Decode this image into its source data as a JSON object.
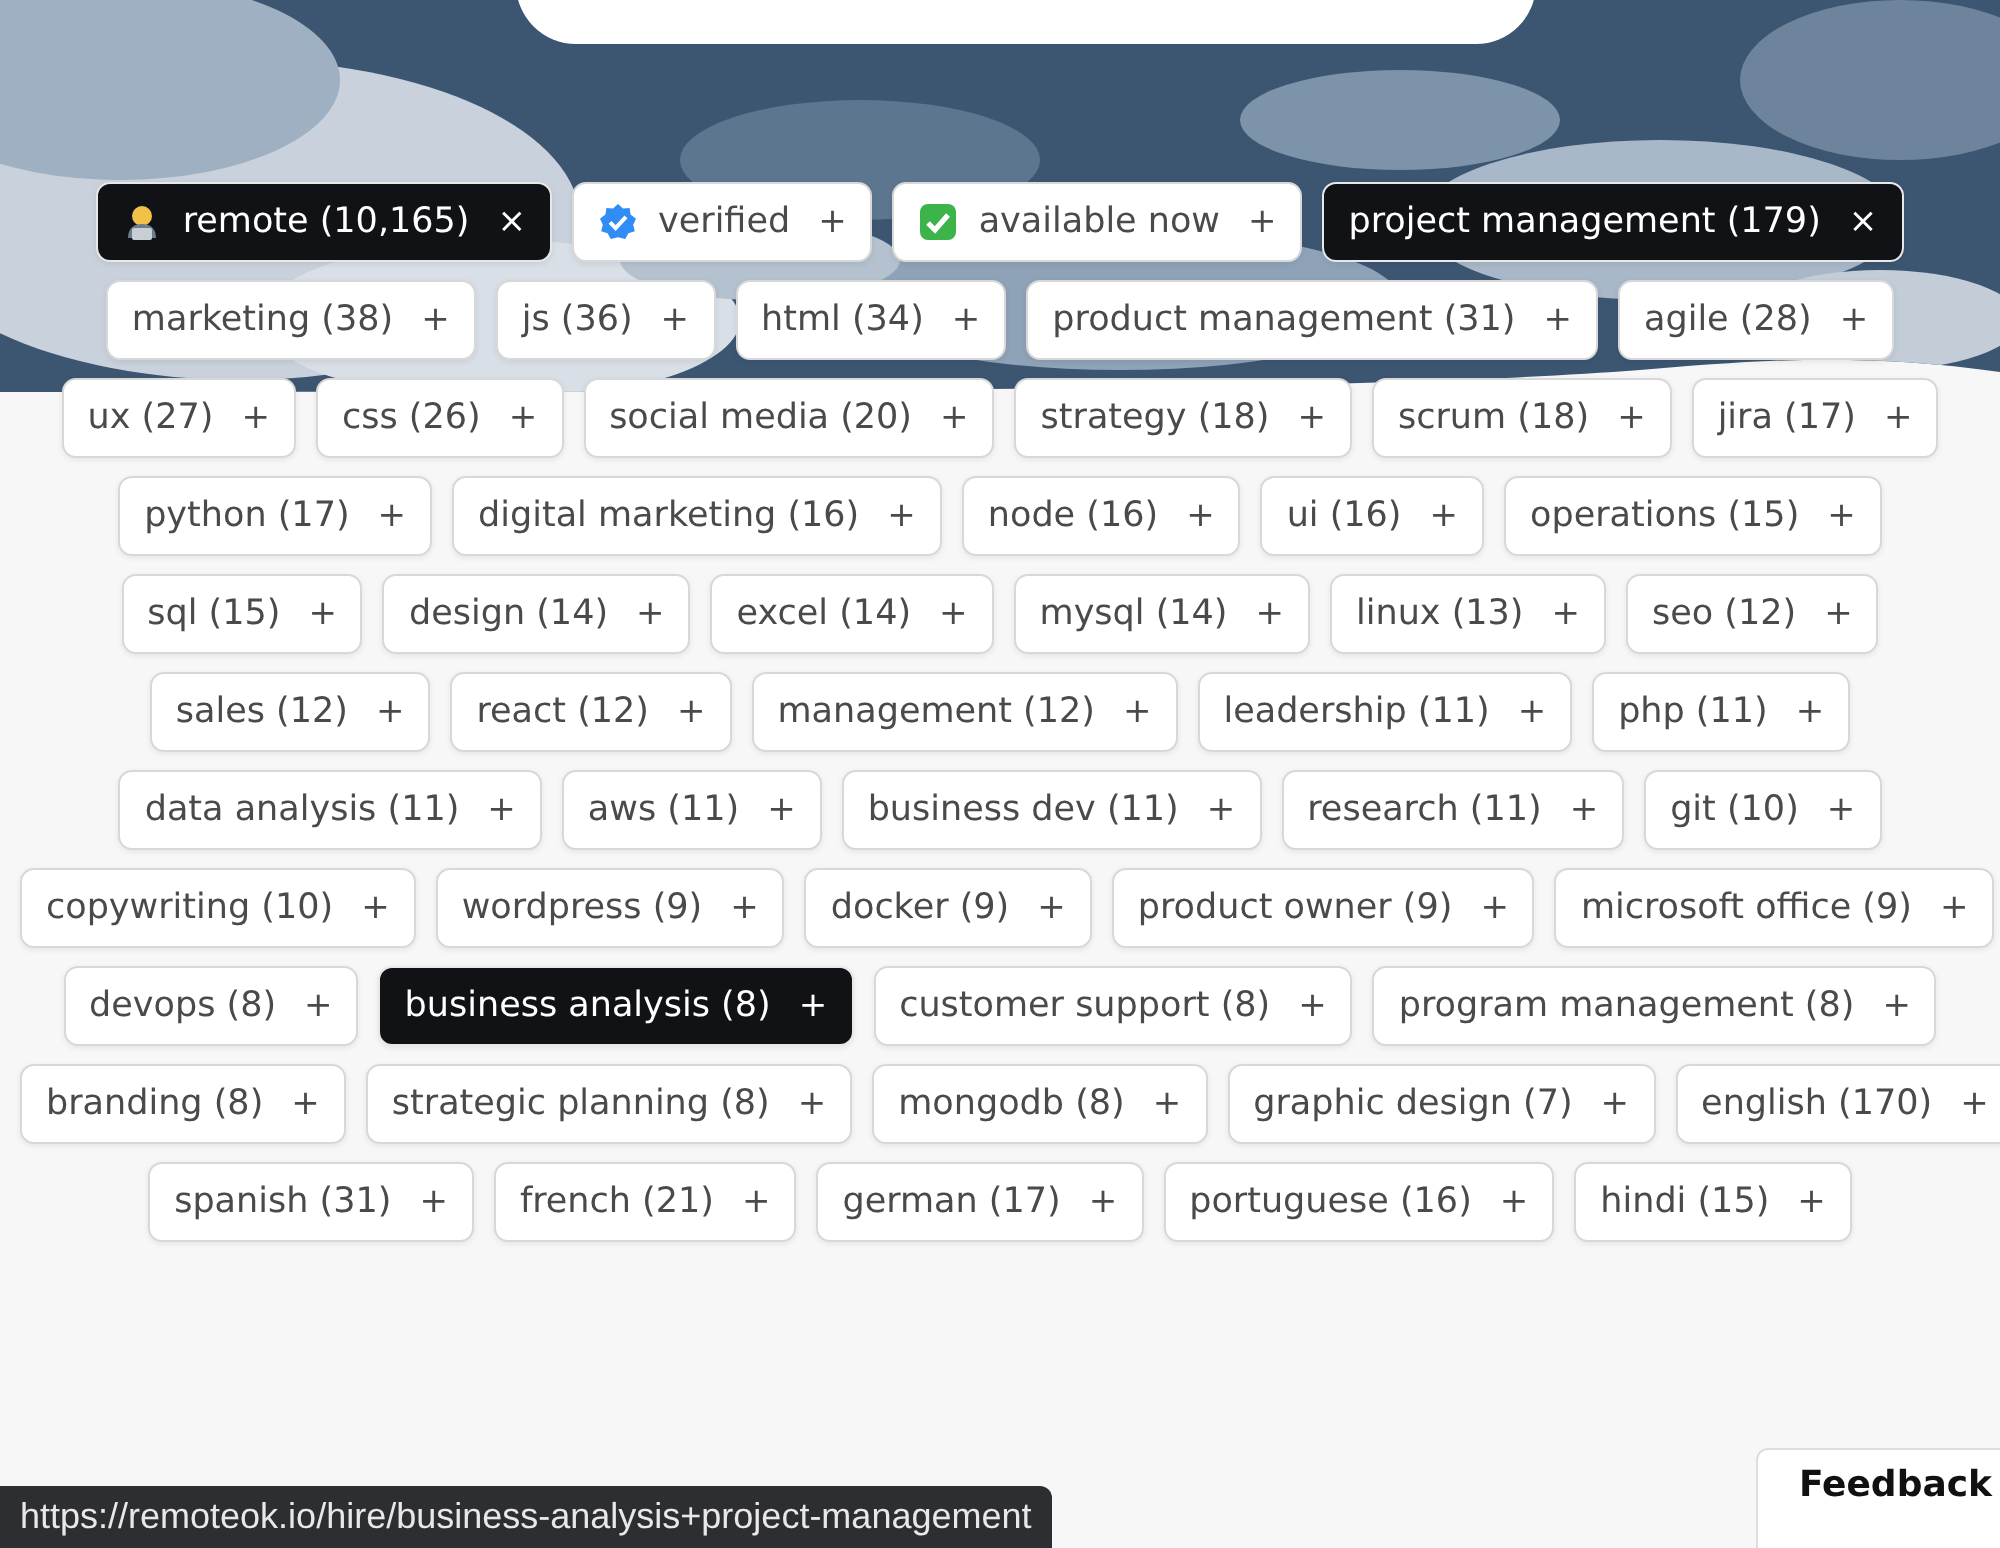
{
  "tag_rows": [
    [
      {
        "label": "remote (10,165)",
        "action": "×",
        "selected": true,
        "kind": "worker"
      },
      {
        "label": "verified",
        "action": "+",
        "selected": false,
        "kind": "verified"
      },
      {
        "label": "available now",
        "action": "+",
        "selected": false,
        "kind": "check"
      },
      {
        "label": "project management (179)",
        "action": "×",
        "selected": true,
        "kind": "plain"
      }
    ],
    [
      {
        "label": "marketing (38)",
        "action": "+",
        "selected": false,
        "kind": "plain"
      },
      {
        "label": "js (36)",
        "action": "+",
        "selected": false,
        "kind": "plain"
      },
      {
        "label": "html (34)",
        "action": "+",
        "selected": false,
        "kind": "plain"
      },
      {
        "label": "product management (31)",
        "action": "+",
        "selected": false,
        "kind": "plain"
      },
      {
        "label": "agile (28)",
        "action": "+",
        "selected": false,
        "kind": "plain"
      }
    ],
    [
      {
        "label": "ux (27)",
        "action": "+",
        "selected": false,
        "kind": "plain"
      },
      {
        "label": "css (26)",
        "action": "+",
        "selected": false,
        "kind": "plain"
      },
      {
        "label": "social media (20)",
        "action": "+",
        "selected": false,
        "kind": "plain"
      },
      {
        "label": "strategy (18)",
        "action": "+",
        "selected": false,
        "kind": "plain"
      },
      {
        "label": "scrum (18)",
        "action": "+",
        "selected": false,
        "kind": "plain"
      },
      {
        "label": "jira (17)",
        "action": "+",
        "selected": false,
        "kind": "plain"
      }
    ],
    [
      {
        "label": "python (17)",
        "action": "+",
        "selected": false,
        "kind": "plain"
      },
      {
        "label": "digital marketing (16)",
        "action": "+",
        "selected": false,
        "kind": "plain"
      },
      {
        "label": "node (16)",
        "action": "+",
        "selected": false,
        "kind": "plain"
      },
      {
        "label": "ui (16)",
        "action": "+",
        "selected": false,
        "kind": "plain"
      },
      {
        "label": "operations (15)",
        "action": "+",
        "selected": false,
        "kind": "plain"
      }
    ],
    [
      {
        "label": "sql (15)",
        "action": "+",
        "selected": false,
        "kind": "plain"
      },
      {
        "label": "design (14)",
        "action": "+",
        "selected": false,
        "kind": "plain"
      },
      {
        "label": "excel (14)",
        "action": "+",
        "selected": false,
        "kind": "plain"
      },
      {
        "label": "mysql (14)",
        "action": "+",
        "selected": false,
        "kind": "plain"
      },
      {
        "label": "linux (13)",
        "action": "+",
        "selected": false,
        "kind": "plain"
      },
      {
        "label": "seo (12)",
        "action": "+",
        "selected": false,
        "kind": "plain"
      }
    ],
    [
      {
        "label": "sales (12)",
        "action": "+",
        "selected": false,
        "kind": "plain"
      },
      {
        "label": "react (12)",
        "action": "+",
        "selected": false,
        "kind": "plain"
      },
      {
        "label": "management (12)",
        "action": "+",
        "selected": false,
        "kind": "plain"
      },
      {
        "label": "leadership (11)",
        "action": "+",
        "selected": false,
        "kind": "plain"
      },
      {
        "label": "php (11)",
        "action": "+",
        "selected": false,
        "kind": "plain"
      }
    ],
    [
      {
        "label": "data analysis (11)",
        "action": "+",
        "selected": false,
        "kind": "plain"
      },
      {
        "label": "aws (11)",
        "action": "+",
        "selected": false,
        "kind": "plain"
      },
      {
        "label": "business dev (11)",
        "action": "+",
        "selected": false,
        "kind": "plain"
      },
      {
        "label": "research (11)",
        "action": "+",
        "selected": false,
        "kind": "plain"
      },
      {
        "label": "git (10)",
        "action": "+",
        "selected": false,
        "kind": "plain"
      }
    ],
    [
      {
        "label": "copywriting (10)",
        "action": "+",
        "selected": false,
        "kind": "plain"
      },
      {
        "label": "wordpress (9)",
        "action": "+",
        "selected": false,
        "kind": "plain"
      },
      {
        "label": "docker (9)",
        "action": "+",
        "selected": false,
        "kind": "plain"
      },
      {
        "label": "product owner (9)",
        "action": "+",
        "selected": false,
        "kind": "plain"
      },
      {
        "label": "microsoft office (9)",
        "action": "+",
        "selected": false,
        "kind": "plain"
      }
    ],
    [
      {
        "label": "devops (8)",
        "action": "+",
        "selected": false,
        "kind": "plain"
      },
      {
        "label": "business analysis (8)",
        "action": "+",
        "selected": true,
        "kind": "plain"
      },
      {
        "label": "customer support (8)",
        "action": "+",
        "selected": false,
        "kind": "plain"
      },
      {
        "label": "program management (8)",
        "action": "+",
        "selected": false,
        "kind": "plain"
      }
    ],
    [
      {
        "label": "branding (8)",
        "action": "+",
        "selected": false,
        "kind": "plain"
      },
      {
        "label": "strategic planning (8)",
        "action": "+",
        "selected": false,
        "kind": "plain"
      },
      {
        "label": "mongodb (8)",
        "action": "+",
        "selected": false,
        "kind": "plain"
      },
      {
        "label": "graphic design (7)",
        "action": "+",
        "selected": false,
        "kind": "plain"
      },
      {
        "label": "english (170)",
        "action": "+",
        "selected": false,
        "kind": "plain"
      }
    ],
    [
      {
        "label": "spanish (31)",
        "action": "+",
        "selected": false,
        "kind": "plain"
      },
      {
        "label": "french (21)",
        "action": "+",
        "selected": false,
        "kind": "plain"
      },
      {
        "label": "german (17)",
        "action": "+",
        "selected": false,
        "kind": "plain"
      },
      {
        "label": "portuguese (16)",
        "action": "+",
        "selected": false,
        "kind": "plain"
      },
      {
        "label": "hindi (15)",
        "action": "+",
        "selected": false,
        "kind": "plain"
      }
    ]
  ],
  "status_bar": {
    "url": "https://remoteok.io/hire/business-analysis+project-management"
  },
  "feedback_button": {
    "label": "Feedback"
  }
}
